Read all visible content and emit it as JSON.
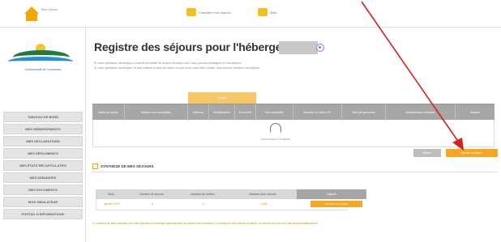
{
  "app": {
    "logo_text": "Taxe Séjour",
    "top_links": [
      "Consulter mes séjours",
      "Aide"
    ]
  },
  "sidebar": {
    "org_caption": "Communauté de Communes",
    "items": [
      {
        "label": "TABLEAU DE BORD"
      },
      {
        "label": "MES HÉBERGEMENTS"
      },
      {
        "label": "MES DÉCLARATIONS"
      },
      {
        "label": "MES RÈGLEMENTS"
      },
      {
        "label": "MES ÉTATS RÉCAPITULATIFS"
      },
      {
        "label": "MES DEMANDES"
      },
      {
        "label": "MES DOCUMENTS"
      },
      {
        "label": "MON SIMULATEUR"
      },
      {
        "label": "PORTAIL D'INFORMATIONS"
      }
    ]
  },
  "main": {
    "title": "Registre des séjours pour l'hébergement :",
    "sub1": "Si votre opérateur numérique a collecté la totalité de la taxe de séjour due, vous pouvez renseigner ici vos séjours.",
    "sub2": "Si votre opérateur numérique n'a pas collecté la taxe de séjour ou que vous vous êtes trompé, vous pouvez déclarer vos séjours.",
    "table": {
      "group_label": "Nuitées",
      "headers": [
        "Dates du séjour",
        "Nuitées non assujetties",
        "Mineurs",
        "Bénéficiaires",
        "Exonérés",
        "Non assujettis",
        "Montant de séjour HT",
        "Tarif par personne",
        "Montant taxe collectée",
        "Actions"
      ],
      "empty_text": "Aucun séjour enregistré"
    },
    "btn_secondary": "Retour",
    "btn_primary": "Ajouter un séjour",
    "summary_title": "SYNTHÈSE DE MES SÉJOURS",
    "summary": {
      "headers": [
        "Mois",
        "Nombre de séjours",
        "Nombre de nuitées",
        "Montant taxe collecté",
        "Actions"
      ],
      "rows": [
        {
          "month": "janvier 2024",
          "stays": "0",
          "nights": "0",
          "amount": "0,00€",
          "action": "Déclarer le montant"
        }
      ]
    },
    "footnote": "Le montant de taxe collectée par votre opérateur numérique apparaît dans la colonne des montants. Il correspond aux séjours déclarés, le montant du mois est calculé automatiquement."
  },
  "colors": {
    "accent": "#f5a623",
    "header_grey": "#a6a6a6",
    "arrow": "#d32020"
  }
}
